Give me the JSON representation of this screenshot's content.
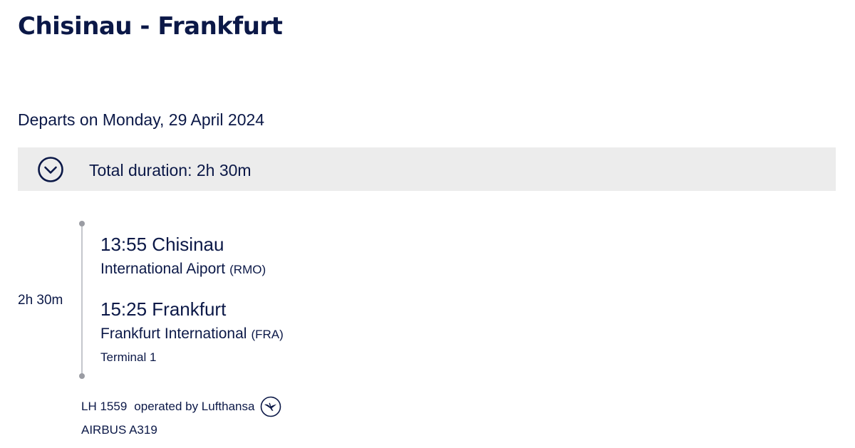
{
  "header": {
    "route_title": "Chisinau - Frankfurt"
  },
  "departure": {
    "date_text": "Departs on Monday, 29 April 2024"
  },
  "summary": {
    "total_duration": "Total duration: 2h 30m",
    "toggle_icon": "chevron-down-circle-icon"
  },
  "segment": {
    "duration": "2h 30m",
    "departure": {
      "time_city": "13:55 Chisinau",
      "airport": "International Aiport",
      "code": "(RMO)"
    },
    "arrival": {
      "time_city": "15:25 Frankfurt",
      "airport": "Frankfurt International",
      "code": "(FRA)",
      "terminal": "Terminal 1"
    },
    "flight_number": "LH 1559",
    "operated_by": "operated by Lufthansa",
    "airline_logo": "lufthansa-crane-logo",
    "aircraft": "AIRBUS A319"
  },
  "colors": {
    "text": "#0b1847",
    "summary_bg": "#ececec",
    "timeline": "#c4c6cc"
  }
}
